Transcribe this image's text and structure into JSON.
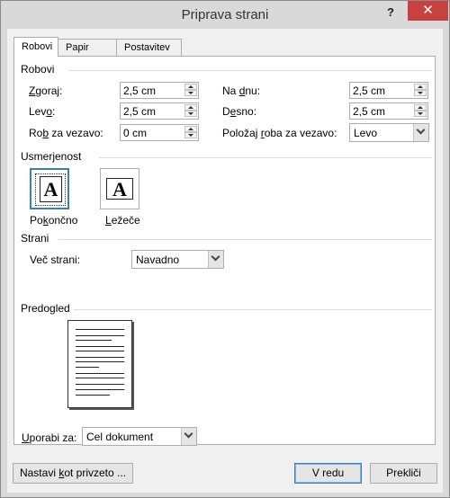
{
  "window": {
    "title": "Priprava strani",
    "help_label": "?",
    "close_label": "✕"
  },
  "tabs": [
    {
      "label": "Robovi",
      "active": true
    },
    {
      "label": "Papir",
      "active": false
    },
    {
      "label": "Postavitev",
      "active": false
    }
  ],
  "margins": {
    "section_title": "Robovi",
    "top": {
      "label_pre": "",
      "label_key": "Z",
      "label_post": "goraj:",
      "value": "2,5 cm"
    },
    "bottom": {
      "label_pre": "Na ",
      "label_key": "d",
      "label_post": "nu:",
      "value": "2,5 cm"
    },
    "left": {
      "label_pre": "Lev",
      "label_key": "o",
      "label_post": ":",
      "value": "2,5 cm"
    },
    "right": {
      "label_pre": "D",
      "label_key": "e",
      "label_post": "sno:",
      "value": "2,5 cm"
    },
    "gutter": {
      "label_pre": "Ro",
      "label_key": "b",
      "label_post": " za vezavo:",
      "value": "0 cm"
    },
    "gutter_position": {
      "label_pre": "Položaj ",
      "label_key": "r",
      "label_post": "oba za vezavo:",
      "value": "Levo"
    }
  },
  "orientation": {
    "section_title": "Usmerjenost",
    "glyph": "A",
    "portrait": {
      "label_pre": "Po",
      "label_key": "k",
      "label_post": "ončno",
      "selected": true
    },
    "landscape": {
      "label_pre": "",
      "label_key": "L",
      "label_post": "ežeče",
      "selected": false
    }
  },
  "pages": {
    "section_title": "Strani",
    "multiple_label_pre": "Več strani:",
    "multiple_value": "Navadno"
  },
  "preview": {
    "section_title": "Predogled",
    "apply_label_pre": "",
    "apply_label_key": "U",
    "apply_label_post": "porabi za:",
    "apply_value": "Cel dokument"
  },
  "buttons": {
    "set_default_pre": "Nastavi ",
    "set_default_key": "k",
    "set_default_post": "ot privzeto ...",
    "ok": "V redu",
    "cancel": "Prekliči"
  },
  "colors": {
    "close_red": "#c7413f",
    "focus_blue": "#3c7fb1"
  }
}
